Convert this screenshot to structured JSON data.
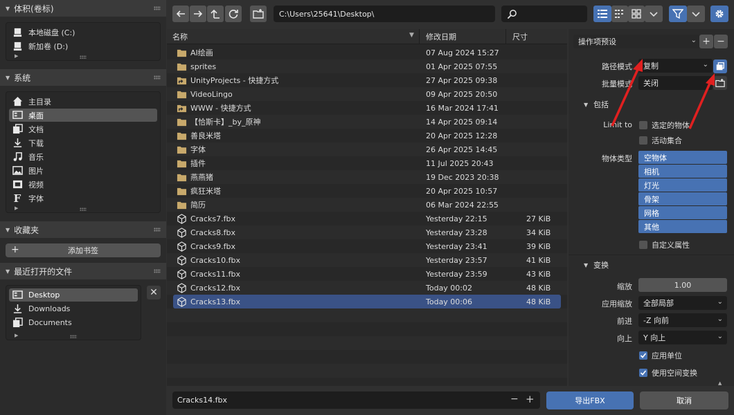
{
  "left": {
    "volumes": {
      "title": "体积(卷标)",
      "items": [
        {
          "label": "本地磁盘 (C:)",
          "icon": "disk-icon"
        },
        {
          "label": "新加卷 (D:)",
          "icon": "disk-icon"
        }
      ]
    },
    "system": {
      "title": "系统",
      "items": [
        {
          "label": "主目录",
          "icon": "home-icon"
        },
        {
          "label": "桌面",
          "icon": "desktop-icon",
          "selected": true
        },
        {
          "label": "文档",
          "icon": "documents-icon"
        },
        {
          "label": "下载",
          "icon": "download-icon"
        },
        {
          "label": "音乐",
          "icon": "music-icon"
        },
        {
          "label": "图片",
          "icon": "image-icon"
        },
        {
          "label": "视频",
          "icon": "video-icon"
        },
        {
          "label": "字体",
          "icon": "font-icon"
        }
      ]
    },
    "bookmarks": {
      "title": "收藏夹",
      "add_label": "添加书签"
    },
    "recent": {
      "title": "最近打开的文件",
      "items": [
        {
          "label": "Desktop",
          "icon": "desktop-icon",
          "selected": true
        },
        {
          "label": "Downloads",
          "icon": "download-icon"
        },
        {
          "label": "Documents",
          "icon": "documents-icon"
        }
      ]
    }
  },
  "toolbar": {
    "path": "C:\\Users\\25641\\Desktop\\",
    "search_value": ""
  },
  "files": {
    "columns": {
      "name": "名称",
      "date": "修改日期",
      "size": "尺寸"
    },
    "rows": [
      {
        "name": "AI绘画",
        "date": "07 Aug 2024 15:27",
        "size": "",
        "type": "folder"
      },
      {
        "name": "sprites",
        "date": "01 Apr 2025 07:55",
        "size": "",
        "type": "folder"
      },
      {
        "name": "UnityProjects - 快捷方式",
        "date": "27 Apr 2025 09:38",
        "size": "",
        "type": "shortcut"
      },
      {
        "name": "VideoLingo",
        "date": "09 Apr 2025 20:50",
        "size": "",
        "type": "folder"
      },
      {
        "name": "WWW - 快捷方式",
        "date": "16 Mar 2024 17:41",
        "size": "",
        "type": "shortcut"
      },
      {
        "name": "【恰斯卡】_by_原神",
        "date": "14 Apr 2025 09:14",
        "size": "",
        "type": "folder"
      },
      {
        "name": "善良米塔",
        "date": "20 Apr 2025 12:28",
        "size": "",
        "type": "folder"
      },
      {
        "name": "字体",
        "date": "26 Apr 2025 14:45",
        "size": "",
        "type": "folder"
      },
      {
        "name": "插件",
        "date": "11 Jul 2025 20:43",
        "size": "",
        "type": "folder"
      },
      {
        "name": "燕燕猪",
        "date": "19 Dec 2023 20:38",
        "size": "",
        "type": "folder"
      },
      {
        "name": "疯狂米塔",
        "date": "20 Apr 2025 10:57",
        "size": "",
        "type": "folder"
      },
      {
        "name": "简历",
        "date": "06 Mar 2024 22:55",
        "size": "",
        "type": "folder"
      },
      {
        "name": "Cracks7.fbx",
        "date": "Yesterday 22:15",
        "size": "27 KiB",
        "type": "fbx"
      },
      {
        "name": "Cracks8.fbx",
        "date": "Yesterday 23:28",
        "size": "34 KiB",
        "type": "fbx"
      },
      {
        "name": "Cracks9.fbx",
        "date": "Yesterday 23:41",
        "size": "39 KiB",
        "type": "fbx"
      },
      {
        "name": "Cracks10.fbx",
        "date": "Yesterday 23:57",
        "size": "41 KiB",
        "type": "fbx"
      },
      {
        "name": "Cracks11.fbx",
        "date": "Yesterday 23:59",
        "size": "43 KiB",
        "type": "fbx"
      },
      {
        "name": "Cracks12.fbx",
        "date": "Today 00:02",
        "size": "48 KiB",
        "type": "fbx"
      },
      {
        "name": "Cracks13.fbx",
        "date": "Today 00:06",
        "size": "48 KiB",
        "type": "fbx",
        "selected": true
      }
    ]
  },
  "right": {
    "preset": "操作项预设",
    "path_mode_label": "路径模式",
    "path_mode_value": "复制",
    "batch_mode_label": "批量模式",
    "batch_mode_value": "关闭",
    "include": {
      "title": "包括",
      "limit_to_label": "Limit to",
      "selected_objects": "选定的物体",
      "active_collection": "活动集合",
      "object_types_label": "物体类型",
      "object_types": [
        "空物体",
        "相机",
        "灯光",
        "骨架",
        "网格",
        "其他"
      ],
      "custom_props": "自定义属性"
    },
    "transform": {
      "title": "变换",
      "scale_label": "缩放",
      "scale_value": "1.00",
      "apply_scale_label": "应用缩放",
      "apply_scale_value": "全部局部",
      "forward_label": "前进",
      "forward_value": "-Z 向前",
      "up_label": "向上",
      "up_value": "Y 向上",
      "apply_unit": "应用单位",
      "use_space_transform": "使用空间变换"
    }
  },
  "bottom": {
    "filename": "Cracks14.fbx",
    "export_label": "导出FBX",
    "cancel_label": "取消"
  },
  "colors": {
    "accent": "#4772b3",
    "selection": "#3a5286",
    "arrow": "#e02020"
  }
}
